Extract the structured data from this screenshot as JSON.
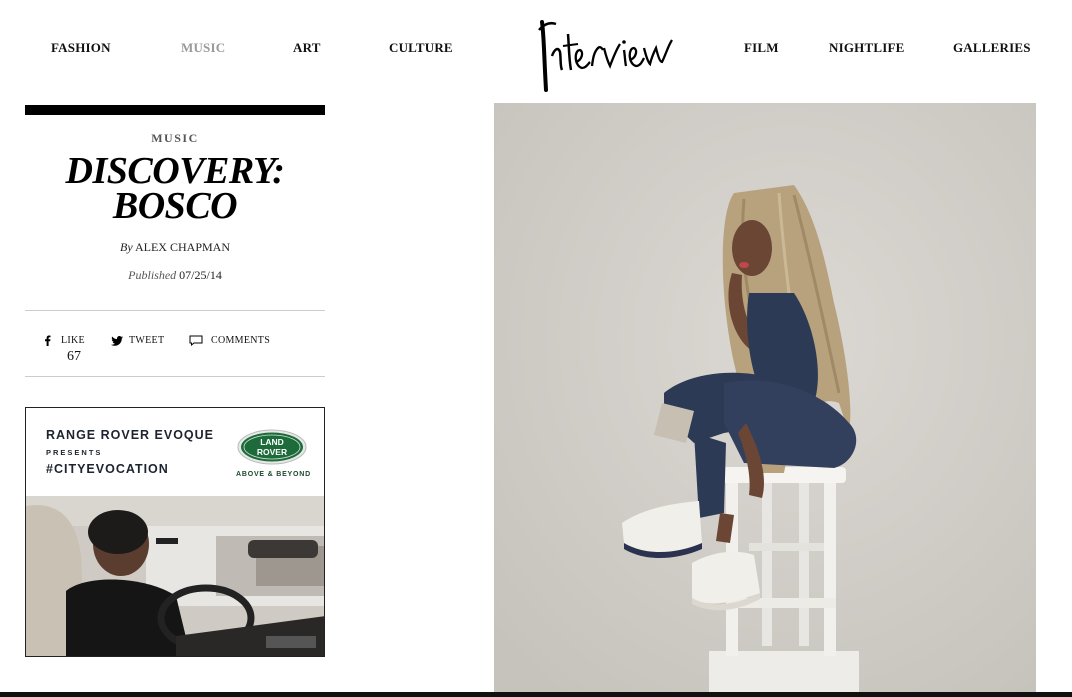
{
  "nav": {
    "left": [
      {
        "label": "FASHION",
        "active": false
      },
      {
        "label": "MUSIC",
        "active": true
      },
      {
        "label": "ART",
        "active": false
      },
      {
        "label": "CULTURE",
        "active": false
      }
    ],
    "right": [
      {
        "label": "FILM",
        "active": false
      },
      {
        "label": "NIGHTLIFE",
        "active": false
      },
      {
        "label": "GALLERIES",
        "active": false
      }
    ],
    "logo_text": "Interview"
  },
  "article": {
    "category": "MUSIC",
    "title_line1": "DISCOVERY:",
    "title_line2": "BOSCO",
    "by_prefix": "By",
    "author": "ALEX CHAPMAN",
    "published_prefix": "Published",
    "published_date": "07/25/14"
  },
  "share": {
    "like_label": "LIKE",
    "like_count": "67",
    "tweet_label": "TWEET",
    "comments_label": "COMMENTS"
  },
  "ad": {
    "line1": "RANGE ROVER EVOQUE",
    "line2": "PRESENTS",
    "line3": "#CITYEVOCATION",
    "badge_line1": "LAND",
    "badge_line2": "ROVER",
    "tagline": "ABOVE & BEYOND"
  },
  "colors": {
    "nav_active": "#9a9a9a",
    "text": "#111111",
    "rule": "#cccccc",
    "land_rover_green": "#1d6b3a",
    "hero_backdrop": "#d3d0cb"
  }
}
